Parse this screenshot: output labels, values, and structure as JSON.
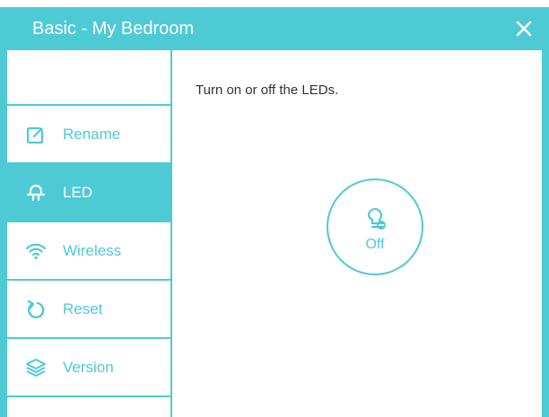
{
  "dialog": {
    "title": "Basic - My Bedroom",
    "close_icon": "close-icon"
  },
  "sidebar": {
    "items": [
      {
        "label": "Rename",
        "icon": "edit-icon",
        "active": false
      },
      {
        "label": "LED",
        "icon": "led-icon",
        "active": true
      },
      {
        "label": "Wireless",
        "icon": "wifi-icon",
        "active": false
      },
      {
        "label": "Reset",
        "icon": "reset-icon",
        "active": false
      },
      {
        "label": "Version",
        "icon": "layers-icon",
        "active": false
      }
    ]
  },
  "main": {
    "description": "Turn on or off the LEDs.",
    "led_toggle": {
      "state_label": "Off",
      "icon": "bulb-off-icon"
    }
  },
  "colors": {
    "accent": "#4ecad5",
    "text": "#333333",
    "background": "#ffffff"
  }
}
